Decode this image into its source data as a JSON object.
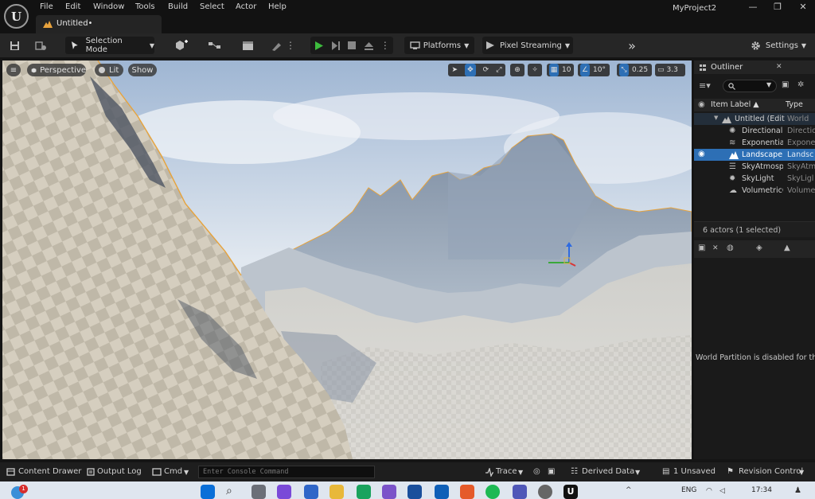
{
  "window": {
    "project_name": "MyProject2",
    "document_tab": "Untitled•",
    "menu": [
      "File",
      "Edit",
      "Window",
      "Tools",
      "Build",
      "Select",
      "Actor",
      "Help"
    ],
    "controls": {
      "minimize": "—",
      "restore": "❐",
      "close": "✕"
    }
  },
  "toolbar": {
    "mode": "Selection Mode",
    "platforms": "Platforms",
    "pixel_streaming": "Pixel Streaming",
    "more": "»",
    "settings": "Settings"
  },
  "viewport": {
    "view_mode": "Perspective",
    "lighting": "Lit",
    "show": "Show",
    "grid_snap": "10",
    "rotation_snap": "10°",
    "scale_snap": "0.25",
    "camera_speed": "3.3"
  },
  "outliner": {
    "title": "Outliner",
    "close": "✕",
    "col_label": "Item Label ▲",
    "col_type": "Type",
    "root": {
      "name": "Untitled (Edito",
      "type": "World"
    },
    "items": [
      {
        "name": "DirectionalL",
        "type": "Directio",
        "icon": "sun-icon"
      },
      {
        "name": "Exponential",
        "type": "Expone",
        "icon": "fog-icon"
      },
      {
        "name": "Landscape",
        "type": "Landsc",
        "icon": "landscape-icon"
      },
      {
        "name": "SkyAtmospl",
        "type": "SkyAtm",
        "icon": "sky-atmosphere-icon"
      },
      {
        "name": "SkyLight",
        "type": "SkyLigl",
        "icon": "skylight-icon"
      },
      {
        "name": "VolumetricC",
        "type": "Volume",
        "icon": "cloud-icon"
      }
    ],
    "summary": "6 actors (1 selected)",
    "world_partition_msg": "World Partition is disabled for this"
  },
  "statusbar": {
    "content_drawer": "Content Drawer",
    "output_log": "Output Log",
    "cmd": "Cmd",
    "console_placeholder": "Enter Console Command",
    "trace": "Trace",
    "derived_data": "Derived Data",
    "unsaved": "1 Unsaved",
    "revision_control": "Revision Control"
  },
  "taskbar": {
    "lang": "ENG",
    "time": "17:34",
    "notif_badge": "1"
  },
  "colors": {
    "accent": "#2d6fb5",
    "play_green": "#3dbb3d",
    "selected_row": "#2d6fb5"
  }
}
